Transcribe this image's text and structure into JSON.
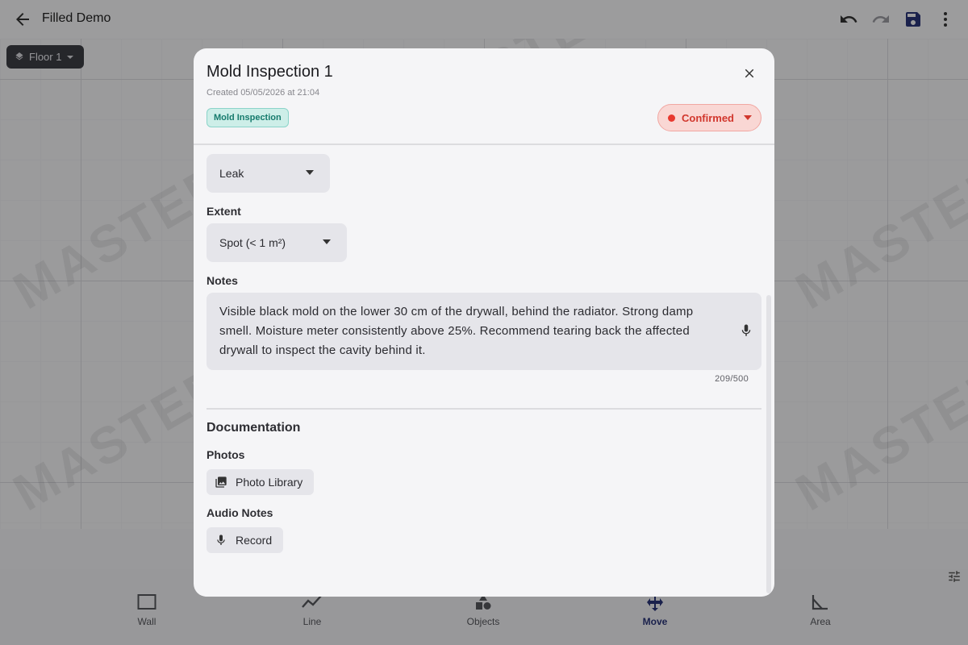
{
  "app": {
    "title": "Filled Demo",
    "floor_label": "Floor 1",
    "watermark": "MASTERPLAN"
  },
  "toolbar": {
    "icons": [
      "back-arrow-icon",
      "undo-icon",
      "redo-icon",
      "save-icon",
      "more-vert-icon"
    ]
  },
  "bottom_nav": {
    "items": [
      {
        "label": "Wall",
        "icon": "wall-icon"
      },
      {
        "label": "Line",
        "icon": "line-icon"
      },
      {
        "label": "Objects",
        "icon": "objects-icon"
      },
      {
        "label": "Move",
        "icon": "move-icon",
        "active": true
      },
      {
        "label": "Area",
        "icon": "area-icon"
      }
    ]
  },
  "dialog": {
    "title": "Mold Inspection 1",
    "created": "Created 05/05/2026 at 21:04",
    "type_tag": "Mold Inspection",
    "status": "Confirmed",
    "status_color": "#e8392f",
    "cause_value": "Leak",
    "extent_label": "Extent",
    "extent_value": "Spot (< 1 m²)",
    "notes_label": "Notes",
    "notes_value": "Visible black mold on the lower 30 cm of the drywall, behind the radiator. Strong damp smell. Moisture meter consistently above 25%. Recommend tearing back the affected drywall to inspect the cavity behind it.",
    "notes_counter": "209/500",
    "documentation_title": "Documentation",
    "photos_label": "Photos",
    "photo_library_button": "Photo Library",
    "audio_label": "Audio Notes",
    "record_button": "Record"
  }
}
